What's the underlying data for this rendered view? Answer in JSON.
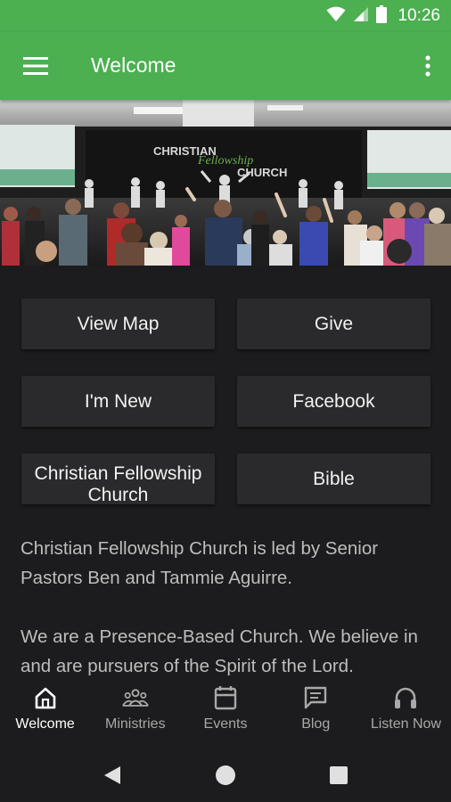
{
  "status_bar": {
    "time": "10:26",
    "icons": [
      "wifi-icon",
      "cell-signal-icon",
      "battery-icon"
    ]
  },
  "app_bar": {
    "title": "Welcome",
    "menu_icon": "hamburger-menu-icon",
    "more_icon": "more-vert-icon",
    "color": "#4caf50"
  },
  "hero": {
    "stage_sign_line1": "CHRISTIAN",
    "stage_sign_script": "Fellowship",
    "stage_sign_line2": "CHURCH"
  },
  "tiles": [
    {
      "label": "View Map"
    },
    {
      "label": "Give"
    },
    {
      "label": "I'm New"
    },
    {
      "label": "Facebook"
    },
    {
      "label": "Christian Fellowship Church"
    },
    {
      "label": "Bible"
    }
  ],
  "description": {
    "paragraph1": "Christian Fellowship Church is led by Senior Pastors Ben and Tammie Aguirre.",
    "paragraph2": "We are a Presence-Based Church. We believe in and are pursuers of the Spirit of the Lord."
  },
  "bottom_nav": [
    {
      "label": "Welcome",
      "icon": "home-icon",
      "active": true
    },
    {
      "label": "Ministries",
      "icon": "people-icon",
      "active": false
    },
    {
      "label": "Events",
      "icon": "calendar-icon",
      "active": false
    },
    {
      "label": "Blog",
      "icon": "chat-bubble-icon",
      "active": false
    },
    {
      "label": "Listen Now",
      "icon": "headphones-icon",
      "active": false
    }
  ],
  "system_nav": {
    "icons": [
      "back-icon",
      "home-circle-icon",
      "recents-icon"
    ]
  }
}
